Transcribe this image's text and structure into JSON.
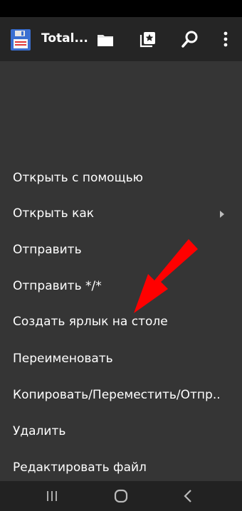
{
  "app": {
    "title": "Total..."
  },
  "toolbar": {
    "icons": [
      "floppy-disk-icon",
      "folder-icon",
      "bookmarks-icon",
      "search-icon",
      "more-vertical-icon"
    ]
  },
  "menu": {
    "items": [
      {
        "label": "Открыть с помощью",
        "has_submenu": false
      },
      {
        "label": "Открыть как",
        "has_submenu": true
      },
      {
        "label": "Отправить",
        "has_submenu": false
      },
      {
        "label": "Отправить */*",
        "has_submenu": false
      },
      {
        "label": "Создать ярлык на столе",
        "has_submenu": false
      },
      {
        "label": "Переименовать",
        "has_submenu": false
      },
      {
        "label": "Копировать/Переместить/Отпр..",
        "has_submenu": false
      },
      {
        "label": "Удалить",
        "has_submenu": false
      },
      {
        "label": "Редактировать файл",
        "has_submenu": false
      }
    ]
  },
  "nav": {
    "icons": [
      "recent-apps-icon",
      "home-icon",
      "back-icon"
    ]
  },
  "colors": {
    "status_bar": "#000000",
    "app_bar": "#252525",
    "menu_bg": "#353535",
    "nav_bar": "#222222",
    "annotation_arrow": "#ff0000",
    "text": "#ffffff"
  }
}
